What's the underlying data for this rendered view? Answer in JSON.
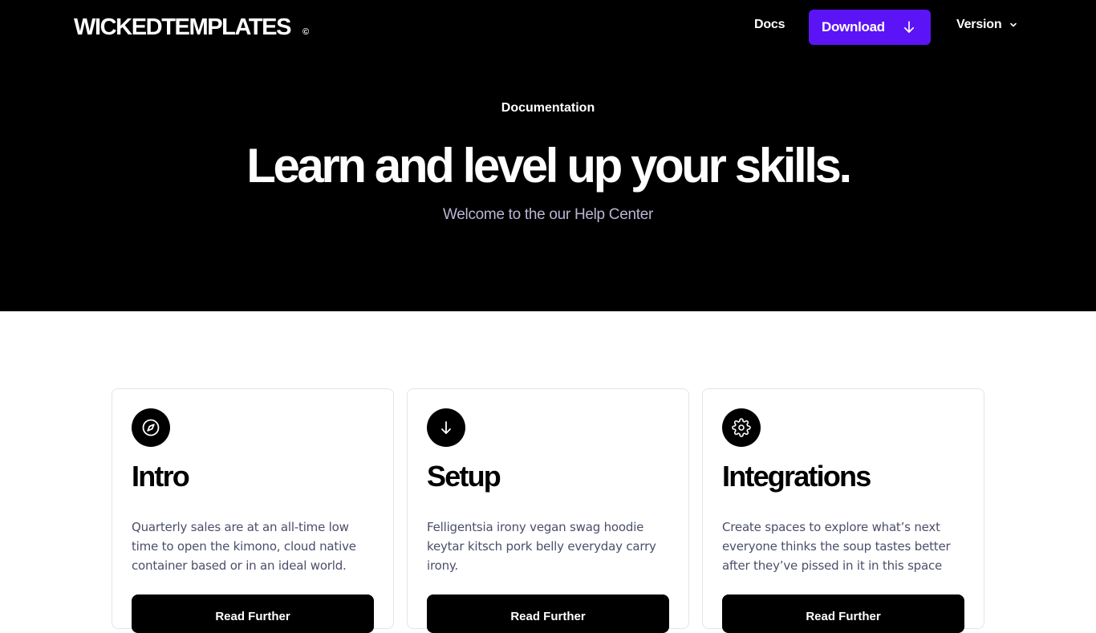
{
  "header": {
    "brand": "WICKEDTEMPLATES",
    "brand_mark": "©",
    "nav_docs": "Docs",
    "download_label": "Download",
    "version_label": "Version"
  },
  "hero": {
    "eyebrow": "Documentation",
    "headline": "Learn and level up your skills.",
    "subline": "Welcome to the our Help Center"
  },
  "cards": [
    {
      "icon": "compass-icon",
      "title": "Intro",
      "description": "Quarterly sales are at an all-time low time to open the kimono, cloud native container based or in an ideal world.",
      "button": "Read Further"
    },
    {
      "icon": "arrow-down-icon",
      "title": "Setup",
      "description": "Felligentsia irony vegan swag hoodie keytar kitsch pork belly everyday carry irony.",
      "button": "Read Further"
    },
    {
      "icon": "gear-icon",
      "title": "Integrations",
      "description": "Create spaces to explore what’s next everyone thinks the soup tastes better after they’ve pissed in it in this space",
      "button": "Read Further"
    }
  ],
  "colors": {
    "hero_bg": "#000000",
    "accent": "#5b14f5",
    "subline": "#b9b6d3",
    "body_text": "#4b4f6b"
  }
}
